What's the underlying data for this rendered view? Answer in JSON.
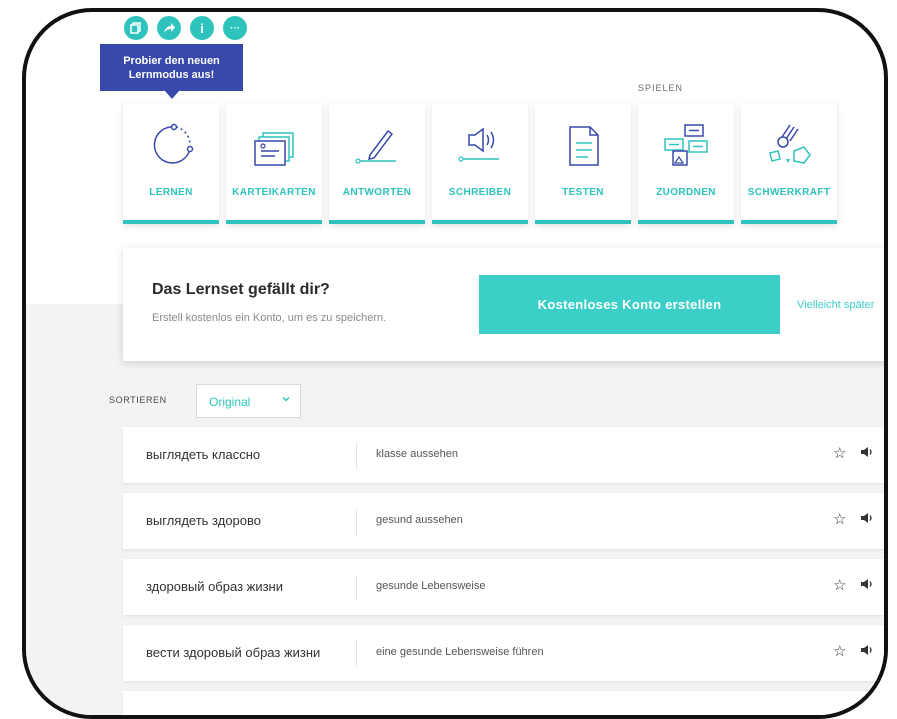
{
  "action_icons": [
    {
      "name": "copy-icon",
      "glyph": "❐"
    },
    {
      "name": "share-icon",
      "glyph": "➦"
    },
    {
      "name": "info-icon",
      "glyph": "i"
    },
    {
      "name": "more-icon",
      "glyph": "···"
    }
  ],
  "tooltip": "Probier den neuen Lernmodus aus!",
  "section_label": "SPIELEN",
  "modes": [
    {
      "label": "LERNEN",
      "icon": "learn-icon"
    },
    {
      "label": "KARTEIKARTEN",
      "icon": "flashcards-icon"
    },
    {
      "label": "ANTWORTEN",
      "icon": "write-icon"
    },
    {
      "label": "SCHREIBEN",
      "icon": "spell-icon"
    },
    {
      "label": "TESTEN",
      "icon": "test-icon"
    },
    {
      "label": "ZUORDNEN",
      "icon": "match-icon"
    },
    {
      "label": "SCHWERKRAFT",
      "icon": "gravity-icon"
    }
  ],
  "promo": {
    "title": "Das Lernset gefällt dir?",
    "subtitle": "Erstell kostenlos ein Konto, um es zu speichern.",
    "button": "Kostenloses Konto erstellen",
    "later": "Vielleicht später"
  },
  "sort": {
    "label": "SORTIEREN",
    "value": "Original"
  },
  "terms": [
    {
      "term": "выглядеть классно",
      "definition": "klasse aussehen"
    },
    {
      "term": "выглядеть здорово",
      "definition": "gesund aussehen"
    },
    {
      "term": "здоровый образ жизни",
      "definition": "gesunde Lebensweise"
    },
    {
      "term": "вести здоровый образ жизни",
      "definition": "eine gesunde Lebensweise führen"
    }
  ],
  "colors": {
    "accent": "#2ec4bd",
    "tooltip": "#3949ab",
    "button": "#3ccfc8"
  }
}
